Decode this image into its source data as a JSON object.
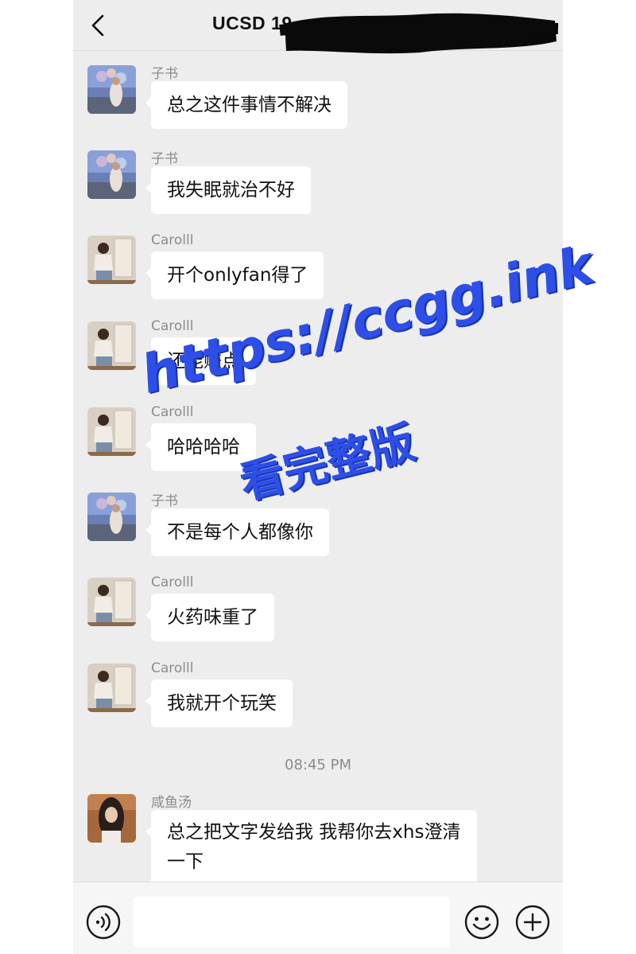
{
  "header": {
    "title": "UCSD 19"
  },
  "messages": [
    {
      "sender": "子书",
      "text": "总之这件事情不解决",
      "avatar": "avatar-zishu"
    },
    {
      "sender": "子书",
      "text": "我失眠就治不好",
      "avatar": "avatar-zishu"
    },
    {
      "sender": "Carolll",
      "text": "开个onlyfan得了",
      "avatar": "avatar-carolll"
    },
    {
      "sender": "Carolll",
      "text": "还能赚点",
      "avatar": "avatar-carolll"
    },
    {
      "sender": "Carolll",
      "text": "哈哈哈哈",
      "avatar": "avatar-carolll"
    },
    {
      "sender": "子书",
      "text": "不是每个人都像你",
      "avatar": "avatar-zishu"
    },
    {
      "sender": "Carolll",
      "text": "火药味重了",
      "avatar": "avatar-carolll"
    },
    {
      "sender": "Carolll",
      "text": "我就开个玩笑",
      "avatar": "avatar-carolll"
    },
    {
      "sender": "咸鱼汤",
      "text": "总之把文字发给我 我帮你去xhs澄清一下",
      "avatar": "avatar-xianyutang"
    }
  ],
  "timestamp": "08:45 PM",
  "watermark": {
    "line1": "https://ccgg.ink",
    "line2": "看完整版"
  },
  "input_bar": {
    "placeholder": "",
    "icons": [
      "voice-icon",
      "emoji-icon",
      "plus-icon"
    ]
  },
  "colors": {
    "background": "#ededed",
    "bubble": "#ffffff",
    "sender_name": "#8c8c8c",
    "watermark": "#2d4fe8"
  }
}
